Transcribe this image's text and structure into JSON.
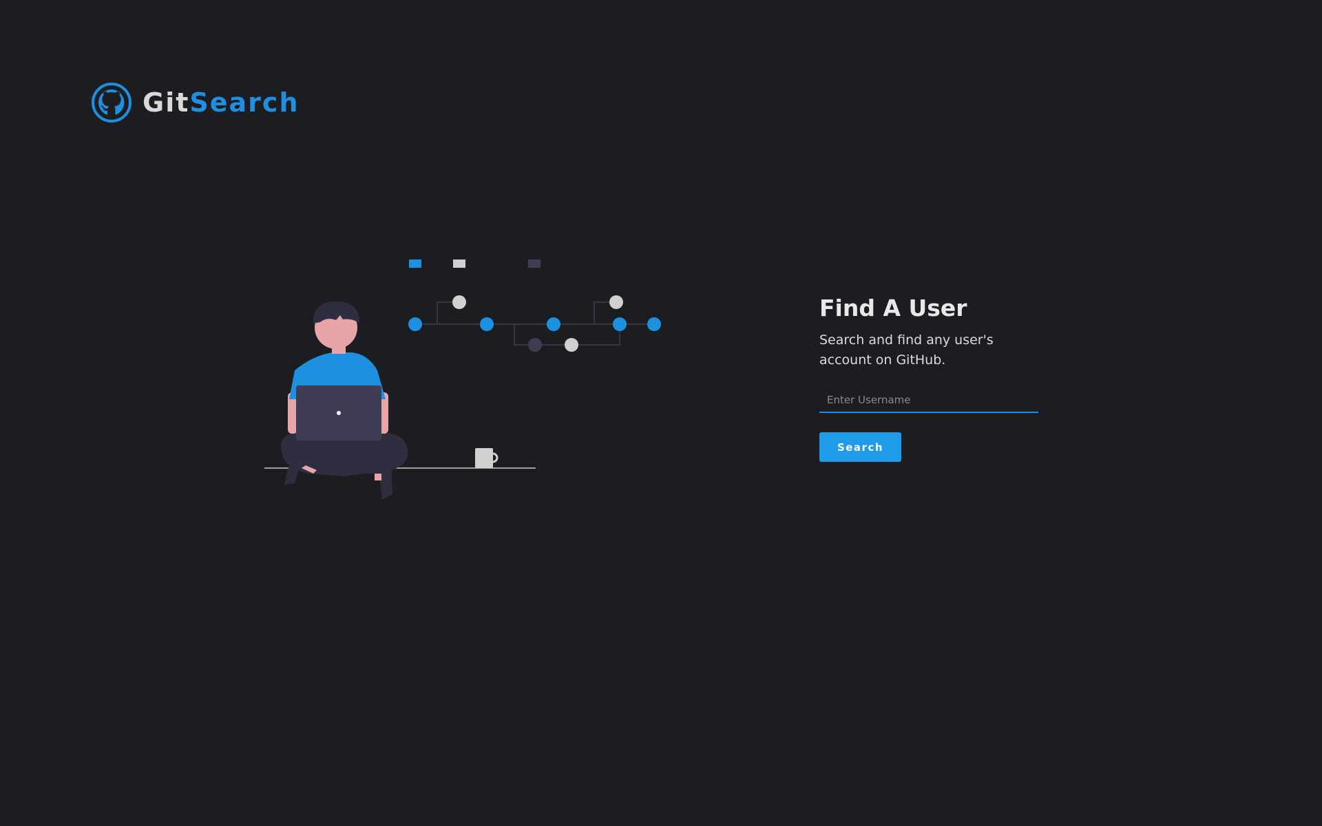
{
  "brand": {
    "name_part1": "Git",
    "name_part2": "Search",
    "logo_icon": "github-octocat-icon",
    "accent_color": "#1e90e2"
  },
  "search_panel": {
    "title": "Find A User",
    "description": "Search and find any user's account on GitHub.",
    "input": {
      "value": "",
      "placeholder": "Enter Username"
    },
    "button_label": "Search"
  },
  "colors": {
    "background": "#1c1d21",
    "accent": "#1e90e2",
    "button": "#1e9be9",
    "muted_node": "#3f3d56",
    "light_node": "#d0d0d0"
  }
}
